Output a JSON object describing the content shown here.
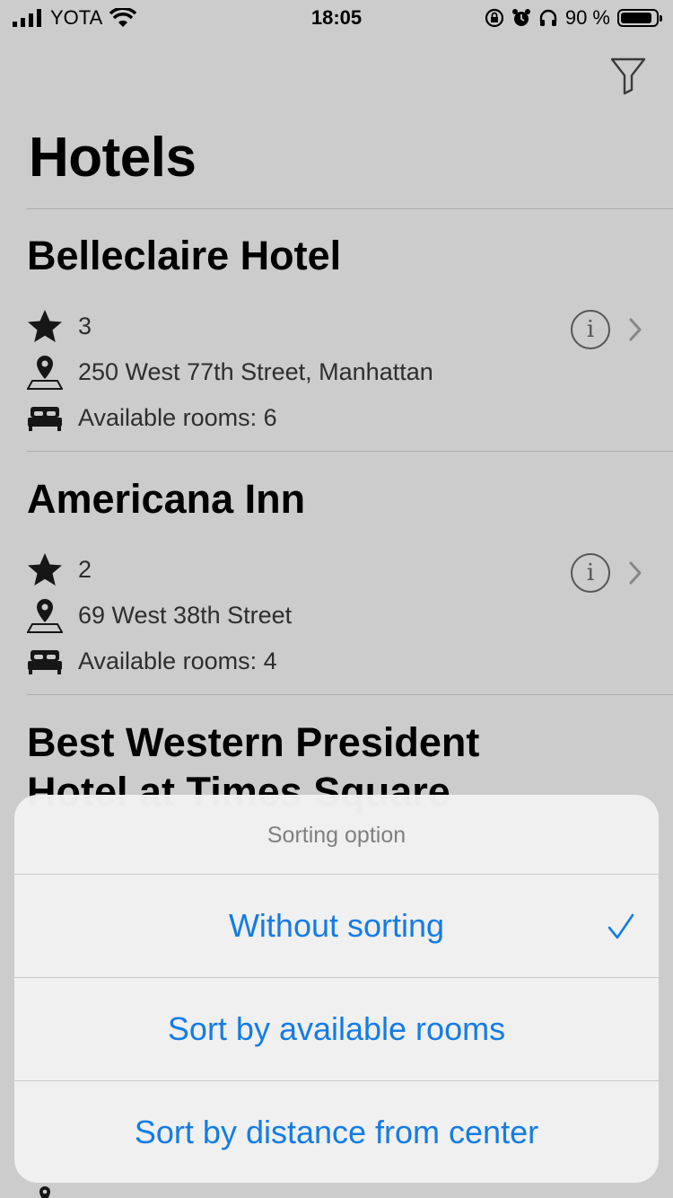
{
  "status_bar": {
    "carrier": "YOTA",
    "time": "18:05",
    "battery_text": "90 %",
    "battery_level": 0.9
  },
  "header": {
    "title": "Hotels",
    "filter_icon": "filter-funnel-icon"
  },
  "hotels": [
    {
      "name": "Belleclaire Hotel",
      "stars": "3",
      "address": "250 West 77th Street, Manhattan",
      "rooms": "Available rooms: 6"
    },
    {
      "name": "Americana Inn",
      "stars": "2",
      "address": "69 West 38th Street",
      "rooms": "Available rooms: 4"
    },
    {
      "name_line1": "Best Western President",
      "name_line2": "Hotel at Times Square"
    }
  ],
  "sheet": {
    "title": "Sorting option",
    "options": [
      {
        "label": "Without sorting",
        "selected": true
      },
      {
        "label": "Sort by available rooms",
        "selected": false
      },
      {
        "label": "Sort by distance from center",
        "selected": false
      }
    ]
  },
  "colors": {
    "accent": "#147ce5",
    "background": "#ffffff",
    "dim_overlay": "rgba(0,0,0,0.2)",
    "sheet_background": "#f1f1f1"
  },
  "icons": {
    "star": "star-icon",
    "location": "map-pin-icon",
    "bed": "bed-icon",
    "info": "info-circle-icon",
    "chevron": "chevron-right-icon",
    "check": "checkmark-icon"
  }
}
